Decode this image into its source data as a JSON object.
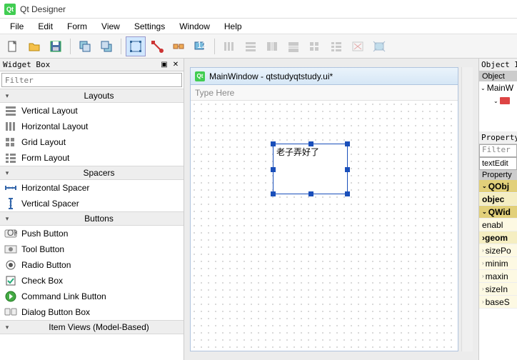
{
  "titlebar": {
    "app_name": "Qt Designer"
  },
  "menubar": [
    "File",
    "Edit",
    "Form",
    "View",
    "Settings",
    "Window",
    "Help"
  ],
  "toolbar": {
    "groups": [
      [
        "new",
        "open",
        "save"
      ],
      [
        "send-back",
        "bring-front"
      ],
      [
        "edit-widgets",
        "edit-signals",
        "edit-buddies",
        "edit-tab-order"
      ],
      [
        "layout-h",
        "layout-v",
        "layout-hsplit",
        "layout-vsplit",
        "layout-grid",
        "layout-form",
        "break-layout",
        "adjust-size"
      ]
    ],
    "active": "edit-widgets",
    "disabled_group": 3
  },
  "widgetbox": {
    "title": "Widget Box",
    "filter_placeholder": "Filter",
    "categories": [
      {
        "name": "Layouts",
        "items": [
          {
            "icon": "layout-v",
            "label": "Vertical Layout"
          },
          {
            "icon": "layout-h",
            "label": "Horizontal Layout"
          },
          {
            "icon": "layout-grid",
            "label": "Grid Layout"
          },
          {
            "icon": "layout-form",
            "label": "Form Layout"
          }
        ]
      },
      {
        "name": "Spacers",
        "items": [
          {
            "icon": "spacer-h",
            "label": "Horizontal Spacer"
          },
          {
            "icon": "spacer-v",
            "label": "Vertical Spacer"
          }
        ]
      },
      {
        "name": "Buttons",
        "items": [
          {
            "icon": "push-btn",
            "label": "Push Button"
          },
          {
            "icon": "tool-btn",
            "label": "Tool Button"
          },
          {
            "icon": "radio",
            "label": "Radio Button"
          },
          {
            "icon": "check",
            "label": "Check Box"
          },
          {
            "icon": "cmd-link",
            "label": "Command Link Button"
          },
          {
            "icon": "dlg-box",
            "label": "Dialog Button Box"
          }
        ]
      },
      {
        "name": "Item Views (Model-Based)",
        "items": []
      }
    ]
  },
  "form": {
    "title": "MainWindow - qtstudyqtstudy.ui*",
    "menubar_hint": "Type Here",
    "selected_widget_text": "老子弄好了"
  },
  "object_inspector": {
    "title": "Object In",
    "col_header": "Object",
    "tree": [
      {
        "level": 0,
        "expand": "v",
        "label": "MainW"
      },
      {
        "level": 1,
        "expand": "v",
        "icon": true,
        "label": ""
      }
    ]
  },
  "property_editor": {
    "title": "Property",
    "filter_placeholder": "Filter",
    "selected_object": "textEdit",
    "col_header": "Property",
    "rows": [
      {
        "type": "cat",
        "label": "QObj",
        "expand": "v"
      },
      {
        "type": "bold",
        "label": "objec"
      },
      {
        "type": "cat",
        "label": "QWid",
        "expand": "v"
      },
      {
        "type": "sub",
        "label": "enabl"
      },
      {
        "type": "bold",
        "label": "geom",
        "chev": ">"
      },
      {
        "type": "sub",
        "label": "sizePo",
        "chev": ">"
      },
      {
        "type": "sub",
        "label": "minim",
        "chev": ">"
      },
      {
        "type": "sub",
        "label": "maxin",
        "chev": ">"
      },
      {
        "type": "sub",
        "label": "sizeIn",
        "chev": ">"
      },
      {
        "type": "sub",
        "label": "baseS",
        "chev": ">"
      }
    ]
  }
}
